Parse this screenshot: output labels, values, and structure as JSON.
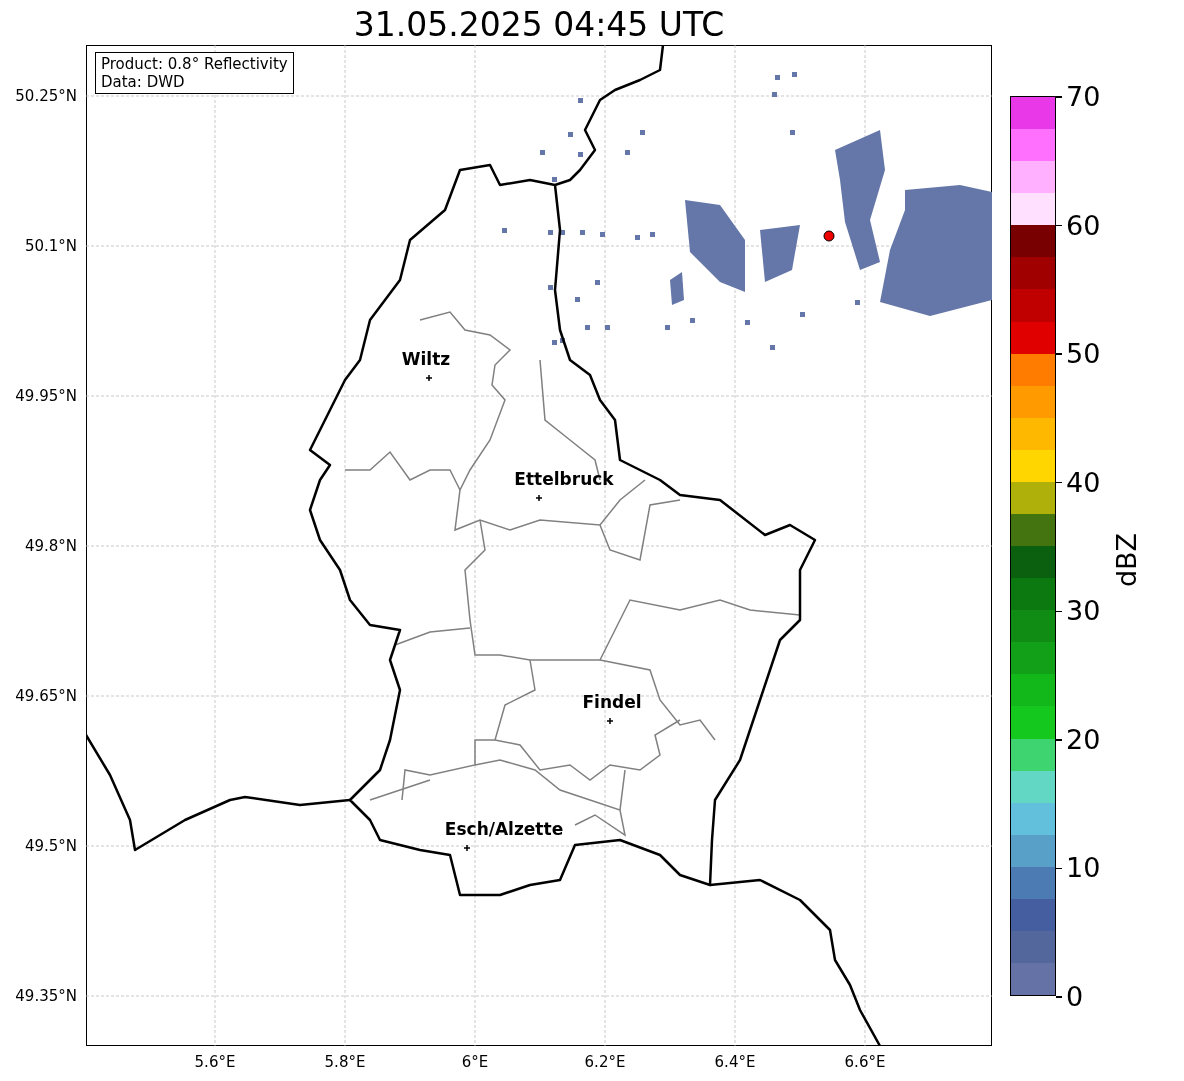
{
  "title": "31.05.2025 04:45 UTC",
  "info_box": {
    "lines": [
      "Product: 0.8° Reflectivity",
      "Data: DWD"
    ]
  },
  "map": {
    "lat_ticks": [
      "50.25°N",
      "50.1°N",
      "49.95°N",
      "49.8°N",
      "49.65°N",
      "49.5°N",
      "49.35°N"
    ],
    "lon_ticks": [
      "5.6°E",
      "5.8°E",
      "6°E",
      "6.2°E",
      "6.4°E",
      "6.6°E"
    ],
    "cities": [
      {
        "name": "Wiltz"
      },
      {
        "name": "Ettelbruck"
      },
      {
        "name": "Findel"
      },
      {
        "name": "Esch/Alzette"
      }
    ]
  },
  "colorbar": {
    "label": "dBZ",
    "ticks": [
      "70",
      "60",
      "50",
      "40",
      "30",
      "20",
      "10",
      "0"
    ],
    "segments": [
      {
        "color": "#e838e8"
      },
      {
        "color": "#ff70ff"
      },
      {
        "color": "#ffb0ff"
      },
      {
        "color": "#ffe0ff"
      },
      {
        "color": "#780000"
      },
      {
        "color": "#a00000"
      },
      {
        "color": "#c00000"
      },
      {
        "color": "#e00000"
      },
      {
        "color": "#ff7c00"
      },
      {
        "color": "#ff9a00"
      },
      {
        "color": "#ffb800"
      },
      {
        "color": "#ffd600"
      },
      {
        "color": "#b0b00a"
      },
      {
        "color": "#447410"
      },
      {
        "color": "#0a600e"
      },
      {
        "color": "#0c7810"
      },
      {
        "color": "#108c14"
      },
      {
        "color": "#12a018"
      },
      {
        "color": "#12b81a"
      },
      {
        "color": "#14c81e"
      },
      {
        "color": "#3ed470"
      },
      {
        "color": "#62d8c4"
      },
      {
        "color": "#62c0dc"
      },
      {
        "color": "#58a0c8"
      },
      {
        "color": "#4b7bb2"
      },
      {
        "color": "#445ea0"
      },
      {
        "color": "#53679d"
      },
      {
        "color": "#6472a6"
      }
    ]
  }
}
